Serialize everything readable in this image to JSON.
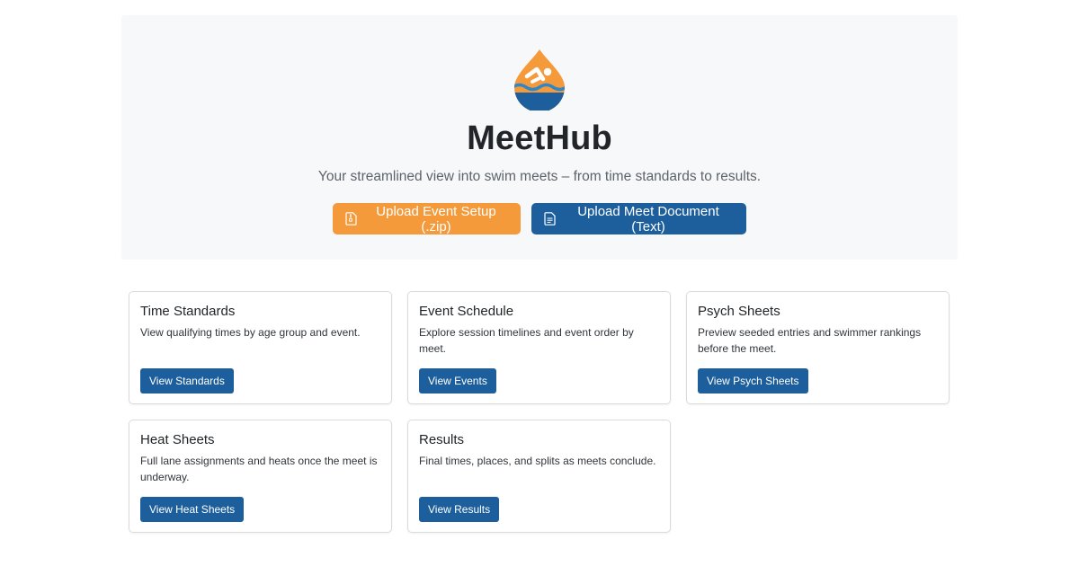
{
  "hero": {
    "logo_icon": "swimmer-drop-icon",
    "title": "MeetHub",
    "tagline": "Your streamlined view into swim meets – from time standards to results.",
    "buttons": [
      {
        "label": "Upload Event Setup (.zip)",
        "icon": "zip-file-icon",
        "color": "#f59a3b"
      },
      {
        "label": "Upload Meet Document (Text)",
        "icon": "text-file-icon",
        "color": "#1c5f9c"
      }
    ]
  },
  "cards": [
    {
      "title": "Time Standards",
      "description": "View qualifying times by age group and event.",
      "button": "View Standards"
    },
    {
      "title": "Event Schedule",
      "description": "Explore session timelines and event order by meet.",
      "button": "View Events"
    },
    {
      "title": "Psych Sheets",
      "description": "Preview seeded entries and swimmer rankings before the meet.",
      "button": "View Psych Sheets"
    },
    {
      "title": "Heat Sheets",
      "description": "Full lane assignments and heats once the meet is underway.",
      "button": "View Heat Sheets"
    },
    {
      "title": "Results",
      "description": "Final times, places, and splits as meets conclude.",
      "button": "View Results"
    }
  ],
  "colors": {
    "primary": "#1c5f9c",
    "accent": "#f59a3b",
    "hero_background": "#f7f8f9"
  }
}
